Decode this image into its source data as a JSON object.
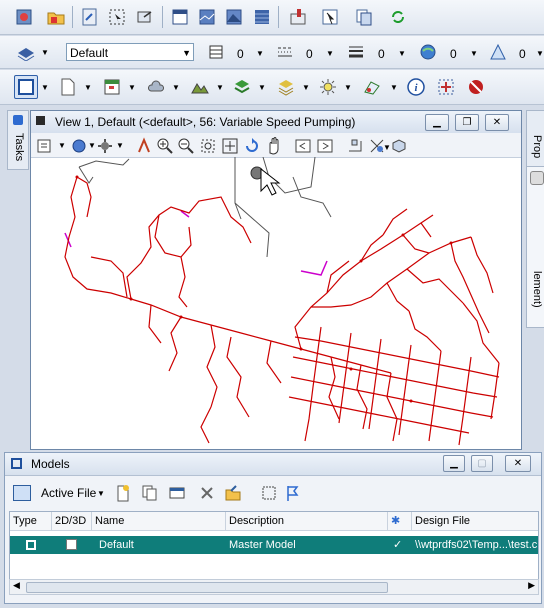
{
  "colors": {
    "accent_row": "#0f7d7a",
    "network": "#cc0000",
    "title_bg": "#dbe4f0"
  },
  "toolbar_row3": {
    "level_value": "Default",
    "color_value": "0",
    "style_value": "0",
    "weight_value": "0",
    "transparency_value": "0",
    "priority_value": "0"
  },
  "left_panel": {
    "tab_label": "Tasks"
  },
  "right_panel": {
    "tab_properties": "Prop",
    "tab_element": "lement)"
  },
  "view": {
    "title": "View 1, Default (<default>, 56: Variable Speed Pumping)"
  },
  "models": {
    "title": "Models",
    "active_file_label": "Active File",
    "columns": [
      "Type",
      "2D/3D",
      "Name",
      "Description",
      "",
      "Design File"
    ],
    "rows": [
      {
        "name": "Default",
        "description": "Master Model",
        "checkmark": "✓",
        "design_file": "\\\\wtprdfs02\\Temp...\\test.c"
      }
    ]
  },
  "icons": [
    "open-icon",
    "close-icon",
    "level-icon",
    "element-info-icon",
    "measure-icon",
    "help-icon",
    "zoom-in-icon",
    "zoom-out-icon",
    "pan-icon",
    "rotate-icon"
  ]
}
